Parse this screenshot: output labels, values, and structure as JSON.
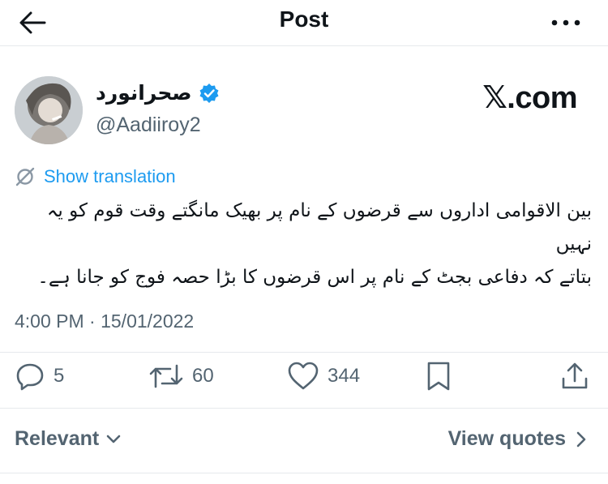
{
  "header": {
    "title": "Post",
    "back_icon": "arrow-left-icon",
    "more_icon": "more-horizontal-icon"
  },
  "author": {
    "display_name": "صحرانورد",
    "verified_icon": "verified-badge-icon",
    "handle": "@Aadiiroy2"
  },
  "watermark": {
    "text": "𝕏.com"
  },
  "translation": {
    "icon": "translate-off-icon",
    "label": "Show translation"
  },
  "tweet": {
    "lines": [
      "بین الاقوامی اداروں سے قرضوں کے نام پر بھیک مانگتے وقت قوم کو یہ نہیں",
      "بتاتے کہ دفاعی بجٹ کے نام پر اس قرضوں کا بڑا حصہ فوج کو جانا ہے۔"
    ]
  },
  "meta": {
    "timestamp": "4:00 PM · 15/01/2022"
  },
  "actions": {
    "replies": "5",
    "reposts": "60",
    "likes": "344"
  },
  "footer": {
    "sort_label": "Relevant",
    "view_quotes_label": "View quotes"
  },
  "colors": {
    "accent": "#1d9bf0",
    "text": "#0f1419",
    "secondary": "#536471",
    "divider": "#e6e9ec"
  }
}
